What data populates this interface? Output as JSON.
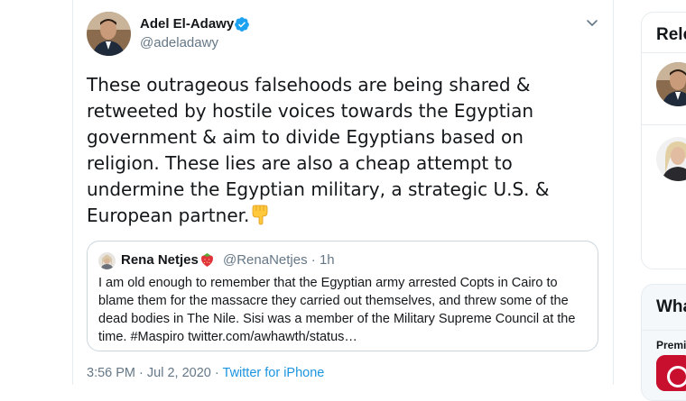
{
  "tweet": {
    "author_name": "Adel El-Adawy",
    "author_handle": "@adeladawy",
    "verified_icon": "verified-badge-icon",
    "text": "These outrageous falsehoods are being shared &\nretweeted by hostile voices towards the Egyptian\ngovernment & aim to divide Egyptians based on\nreligion. These lies are also a cheap attempt to\nundermine the Egyptian military, a strategic U.S. &\nEuropean partner.",
    "trailing_emoji": "backhand-index-pointing-down-icon",
    "time": "3:56 PM",
    "separator": "·",
    "date": "Jul 2, 2020",
    "source": "Twitter for iPhone"
  },
  "quoted": {
    "author_name": "Rena Netjes",
    "emoji": "strawberry-icon",
    "author_handle": "@RenaNetjes",
    "separator": "·",
    "age": "1h",
    "text": "I am old enough to remember that the Egyptian army arrested Copts in Cairo to\nblame them for the massacre they carried out themselves, and threw some of the\ndead bodies in The Nile. Sisi was a member of the Military Supreme Council at the\ntime. #Maspiro twitter.com/awhawth/status…"
  },
  "sidebar": {
    "relevant_title": "Rele",
    "whats_title": "Wha",
    "whats_sub": "Premi"
  },
  "colors": {
    "link": "#1b95e0",
    "muted": "#657786",
    "border": "#e6ecf0",
    "verified": "#1da1f2",
    "text": "#14171a"
  }
}
